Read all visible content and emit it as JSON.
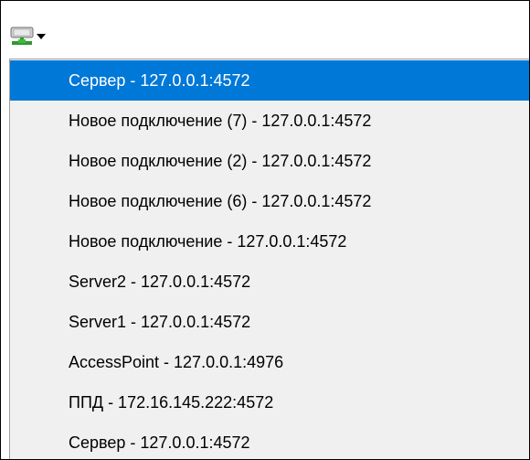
{
  "toolbar": {
    "connection_button_icon": "network-computer-icon",
    "dropdown_icon": "chevron-down-icon"
  },
  "menu": {
    "selected_color": "#0078d7",
    "items": [
      {
        "label": "Сервер - 127.0.0.1:4572",
        "selected": true
      },
      {
        "label": "Новое подключение (7) - 127.0.0.1:4572",
        "selected": false
      },
      {
        "label": "Новое подключение (2) - 127.0.0.1:4572",
        "selected": false
      },
      {
        "label": "Новое подключение (6) - 127.0.0.1:4572",
        "selected": false
      },
      {
        "label": "Новое подключение - 127.0.0.1:4572",
        "selected": false
      },
      {
        "label": "Server2 - 127.0.0.1:4572",
        "selected": false
      },
      {
        "label": "Server1 - 127.0.0.1:4572",
        "selected": false
      },
      {
        "label": "AccessPoint - 127.0.0.1:4976",
        "selected": false
      },
      {
        "label": "ППД - 172.16.145.222:4572",
        "selected": false
      },
      {
        "label": "Сервер - 127.0.0.1:4572",
        "selected": false
      }
    ]
  }
}
